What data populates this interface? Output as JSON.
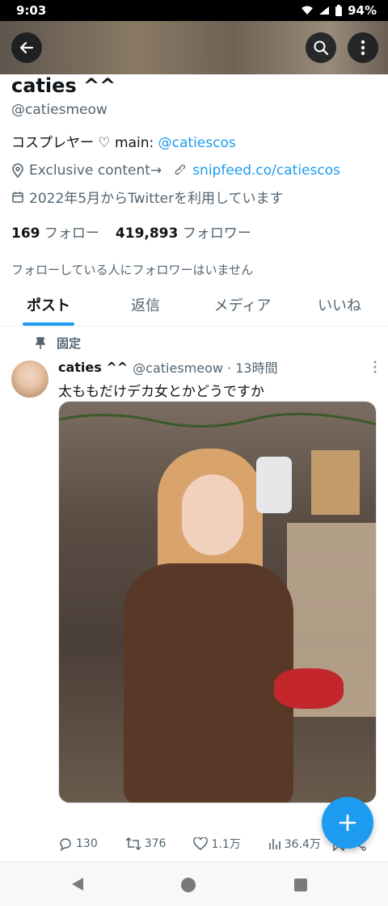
{
  "status": {
    "time": "9:03",
    "battery": "94%"
  },
  "profile": {
    "display_name": "caties ^^",
    "handle": "@catiesmeow",
    "bio_text": "コスプレヤー ♡ main: ",
    "bio_link": "@catiescos",
    "location": "Exclusive content→",
    "website": "snipfeed.co/catiescos",
    "joined": "2022年5月からTwitterを利用しています",
    "following_count": "169",
    "following_label": "フォロー",
    "followers_count": "419,893",
    "followers_label": "フォロワー",
    "no_mutual_followers": "フォローしている人にフォロワーはいません"
  },
  "tabs": [
    {
      "label": "ポスト",
      "active": true
    },
    {
      "label": "返信",
      "active": false
    },
    {
      "label": "メディア",
      "active": false
    },
    {
      "label": "いいね",
      "active": false
    }
  ],
  "pinned_label": "固定",
  "post": {
    "name": "caties ^^",
    "handle_time": "@catiesmeow · 13時間",
    "text": "太ももだけデカ女とかどうですか",
    "replies": "130",
    "reposts": "376",
    "likes": "1.1万",
    "views": "36.4万"
  },
  "colors": {
    "accent": "#1d9bf0",
    "muted": "#536471",
    "text": "#0f1419"
  },
  "icons": [
    "back-arrow-icon",
    "search-icon",
    "more-vertical-icon",
    "location-icon",
    "link-icon",
    "calendar-icon",
    "pin-icon",
    "reply-icon",
    "repost-icon",
    "like-icon",
    "views-icon",
    "bookmark-icon",
    "share-icon",
    "plus-icon"
  ]
}
